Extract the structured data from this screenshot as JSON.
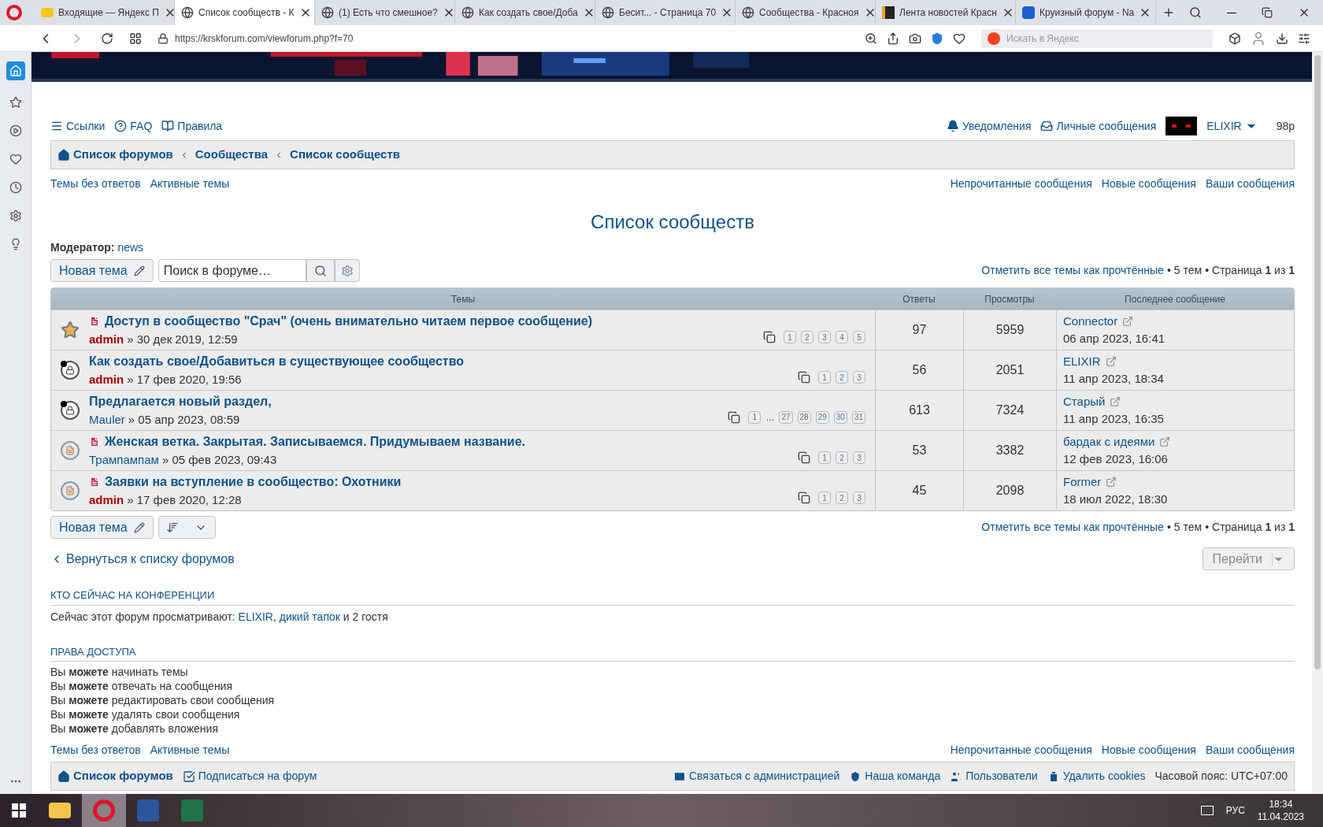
{
  "browser": {
    "tabs": [
      {
        "title": "Входящие — Яндекс П",
        "kind": "mail",
        "selected": false
      },
      {
        "title": "Список сообществ - К",
        "kind": "globe",
        "selected": true
      },
      {
        "title": "(1) Есть что смешное?",
        "kind": "globe",
        "selected": false
      },
      {
        "title": "Как создать свое/Доба",
        "kind": "globe",
        "selected": false
      },
      {
        "title": "Бесит... - Страница 70",
        "kind": "globe",
        "selected": false
      },
      {
        "title": "Сообщества - Красноя",
        "kind": "globe",
        "selected": false
      },
      {
        "title": "Лента новостей Красн",
        "kind": "news",
        "selected": false
      },
      {
        "title": "Круизный форум - Na",
        "kind": "n",
        "selected": false
      }
    ],
    "address": "https://krskforum.com/viewforum.php?f=70",
    "search_placeholder": "Искать в Яндекс"
  },
  "nav": {
    "left": [
      "Ссылки",
      "FAQ",
      "Правила"
    ],
    "notifications": "Уведомления",
    "messages": "Личные сообщения",
    "user": "ELIXIR",
    "points": "98р"
  },
  "breadcrumbs": [
    "Список форумов",
    "Сообщества",
    "Список сообществ"
  ],
  "top_links": {
    "left": [
      "Темы без ответов",
      "Активные темы"
    ],
    "right": [
      "Непрочитанные сообщения",
      "Новые сообщения",
      "Ваши сообщения"
    ]
  },
  "title": "Список сообществ",
  "moderator": {
    "label": "Модератор:",
    "name": "news"
  },
  "top_actions": {
    "new_topic": "Новая тема",
    "search_placeholder": "Поиск в форуме…",
    "mark_read": "Отметить все темы как прочтённые",
    "bullet_1": "•",
    "topics": "5 тем",
    "bullet_2": "•",
    "page": "Страница **1** из **1**"
  },
  "table": {
    "columns": [
      "Темы",
      "Ответы",
      "Просмотры",
      "Последнее сообщение"
    ],
    "rows": [
      {
        "kind": "announce",
        "unread": false,
        "hot": true,
        "title": "Доступ в сообщество \"Срач\" (очень внимательно читаем первое сообщение)",
        "author": "admin",
        "color": "#aa0000",
        "date": "» 30 дек 2019, 12:59",
        "pages": [
          "1",
          "2",
          "3",
          "4",
          "5"
        ],
        "replies": "97",
        "views": "5959",
        "last_author": "Connector",
        "last_date": "06 апр 2023, 16:41"
      },
      {
        "kind": "locked",
        "unread": true,
        "hot": false,
        "title": "Как создать свое/Добавиться в существующее сообщество",
        "author": "admin",
        "color": "#aa0000",
        "date": "» 17 фев 2020, 19:56",
        "pages": [
          "1",
          "2",
          "3"
        ],
        "replies": "56",
        "views": "2051",
        "last_author": "ELIXIR",
        "last_date": "11 апр 2023, 18:34"
      },
      {
        "kind": "locked",
        "unread": true,
        "hot": false,
        "title": "Предлагается новый раздел,",
        "author": "Mauler",
        "color": "#105289",
        "date": "» 05 апр 2023, 08:59",
        "pages": [
          "1",
          "…",
          "27",
          "28",
          "29",
          "30",
          "31"
        ],
        "replies": "613",
        "views": "7324",
        "last_author": "Старый",
        "last_date": "11 апр 2023, 16:35"
      },
      {
        "kind": "topic",
        "unread": false,
        "hot": true,
        "title": "Женская ветка. Закрытая. Записываемся. Придумываем название.",
        "author": "Трампампам",
        "color": "#105289",
        "date": "» 05 фев 2023, 09:43",
        "pages": [
          "1",
          "2",
          "3"
        ],
        "replies": "53",
        "views": "3382",
        "last_author": "бардак с идеями",
        "last_date": "12 фев 2023, 16:06"
      },
      {
        "kind": "topic",
        "unread": false,
        "hot": true,
        "title": "Заявки на вступление в сообщество: Охотники",
        "author": "admin",
        "color": "#aa0000",
        "date": "» 17 фев 2020, 12:28",
        "pages": [
          "1",
          "2",
          "3"
        ],
        "replies": "45",
        "views": "2098",
        "last_author": "Former",
        "last_date": "18 июл 2022, 18:30"
      }
    ]
  },
  "bottom_actions": {
    "new_topic": "Новая тема",
    "mark_read": "Отметить все темы как прочтённые",
    "bullet_1": "•",
    "topics": "5 тем",
    "bullet_2": "•",
    "page": "Страница **1** из **1**"
  },
  "back_link": "Вернуться к списку форумов",
  "jump_button": "Перейти",
  "online": {
    "heading": "КТО СЕЙЧАС НА КОНФЕРЕНЦИИ",
    "prefix": "Сейчас этот форум просматривают:",
    "users": [
      {
        "name": "ELIXIR",
        "separator": ","
      },
      {
        "name": "дикий тапок"
      }
    ],
    "suffix": "и 2 гостя"
  },
  "permissions": {
    "heading": "ПРАВА ДОСТУПА",
    "lines": [
      "Вы **можете** начинать темы",
      "Вы **можете** отвечать на сообщения",
      "Вы **можете** редактировать свои сообщения",
      "Вы **можете** удалять свои сообщения",
      "Вы **можете** добавлять вложения"
    ]
  },
  "bottom_links": {
    "left": [
      "Темы без ответов",
      "Активные темы"
    ],
    "right": [
      "Непрочитанные сообщения",
      "Новые сообщения",
      "Ваши сообщения"
    ]
  },
  "footer": {
    "left": [
      "Список форумов",
      "Подписаться на форум"
    ],
    "right": [
      "Связаться с администрацией",
      "Наша команда",
      "Пользователи",
      "Удалить cookies"
    ],
    "timezone": "Часовой пояс: UTC+07:00"
  },
  "taskbar": {
    "lang": "РУС",
    "time": "18:34",
    "date": "11.04.2023"
  }
}
